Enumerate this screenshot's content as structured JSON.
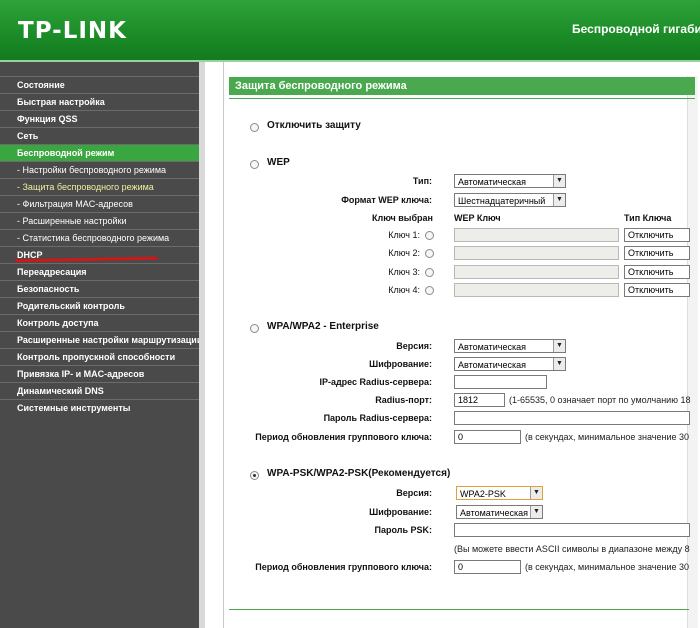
{
  "header": {
    "logo": "TP-LINK",
    "model": "Беспроводной гигабит"
  },
  "sidebar": {
    "items": [
      {
        "label": "Состояние"
      },
      {
        "label": "Быстрая настройка"
      },
      {
        "label": "Функция QSS"
      },
      {
        "label": "Сеть"
      },
      {
        "label": "Беспроводной режим"
      },
      {
        "label": "- Настройки беспроводного режима"
      },
      {
        "label": "- Защита беспроводного режима"
      },
      {
        "label": "- Фильтрация MAC-адресов"
      },
      {
        "label": "- Расширенные настройки"
      },
      {
        "label": "- Статистика беспроводного режима"
      },
      {
        "label": "DHCP"
      },
      {
        "label": "Переадресация"
      },
      {
        "label": "Безопасность"
      },
      {
        "label": "Родительский контроль"
      },
      {
        "label": "Контроль доступа"
      },
      {
        "label": "Расширенные настройки маршрутизации"
      },
      {
        "label": "Контроль пропускной способности"
      },
      {
        "label": "Привязка IP- и MAC-адресов"
      },
      {
        "label": "Динамический DNS"
      },
      {
        "label": "Системные инструменты"
      }
    ]
  },
  "main": {
    "title": "Защита беспроводного режима",
    "disable": {
      "label": "Отключить защиту"
    },
    "wep": {
      "label": "WEP",
      "type_label": "Тип:",
      "type_value": "Автоматическая",
      "format_label": "Формат WEP ключа:",
      "format_value": "Шестнадцатеричный",
      "col_selected": "Ключ выбран",
      "col_key": "WEP Ключ",
      "col_type": "Тип Ключа",
      "keys": [
        {
          "label": "Ключ 1:",
          "type": "Отключить"
        },
        {
          "label": "Ключ 2:",
          "type": "Отключить"
        },
        {
          "label": "Ключ 3:",
          "type": "Отключить"
        },
        {
          "label": "Ключ 4:",
          "type": "Отключить"
        }
      ]
    },
    "enterprise": {
      "label": "WPA/WPA2 - Enterprise",
      "version_label": "Версия:",
      "version_value": "Автоматическая",
      "enc_label": "Шифрование:",
      "enc_value": "Автоматическая",
      "radius_ip_label": "IP-адрес Radius-сервера:",
      "radius_ip_value": "",
      "radius_port_label": "Radius-порт:",
      "radius_port_value": "1812",
      "radius_port_note": "(1-65535, 0 означает порт по умолчанию 18",
      "radius_pass_label": "Пароль Radius-сервера:",
      "radius_pass_value": "",
      "group_label": "Период обновления группового ключа:",
      "group_value": "0",
      "group_note": "(в секундах, минимальное значение 30"
    },
    "psk": {
      "label": "WPA-PSK/WPA2-PSK(Рекомендуется)",
      "version_label": "Версия:",
      "version_value": "WPA2-PSK",
      "enc_label": "Шифрование:",
      "enc_value": "Автоматическая",
      "pass_label": "Пароль PSK:",
      "pass_value": "",
      "pass_note": "(Вы можете ввести ASCII символы в диапазоне между 8",
      "group_label": "Период обновления группового ключа:",
      "group_value": "0",
      "group_note": "(в секундах, минимальное значение 30"
    }
  }
}
